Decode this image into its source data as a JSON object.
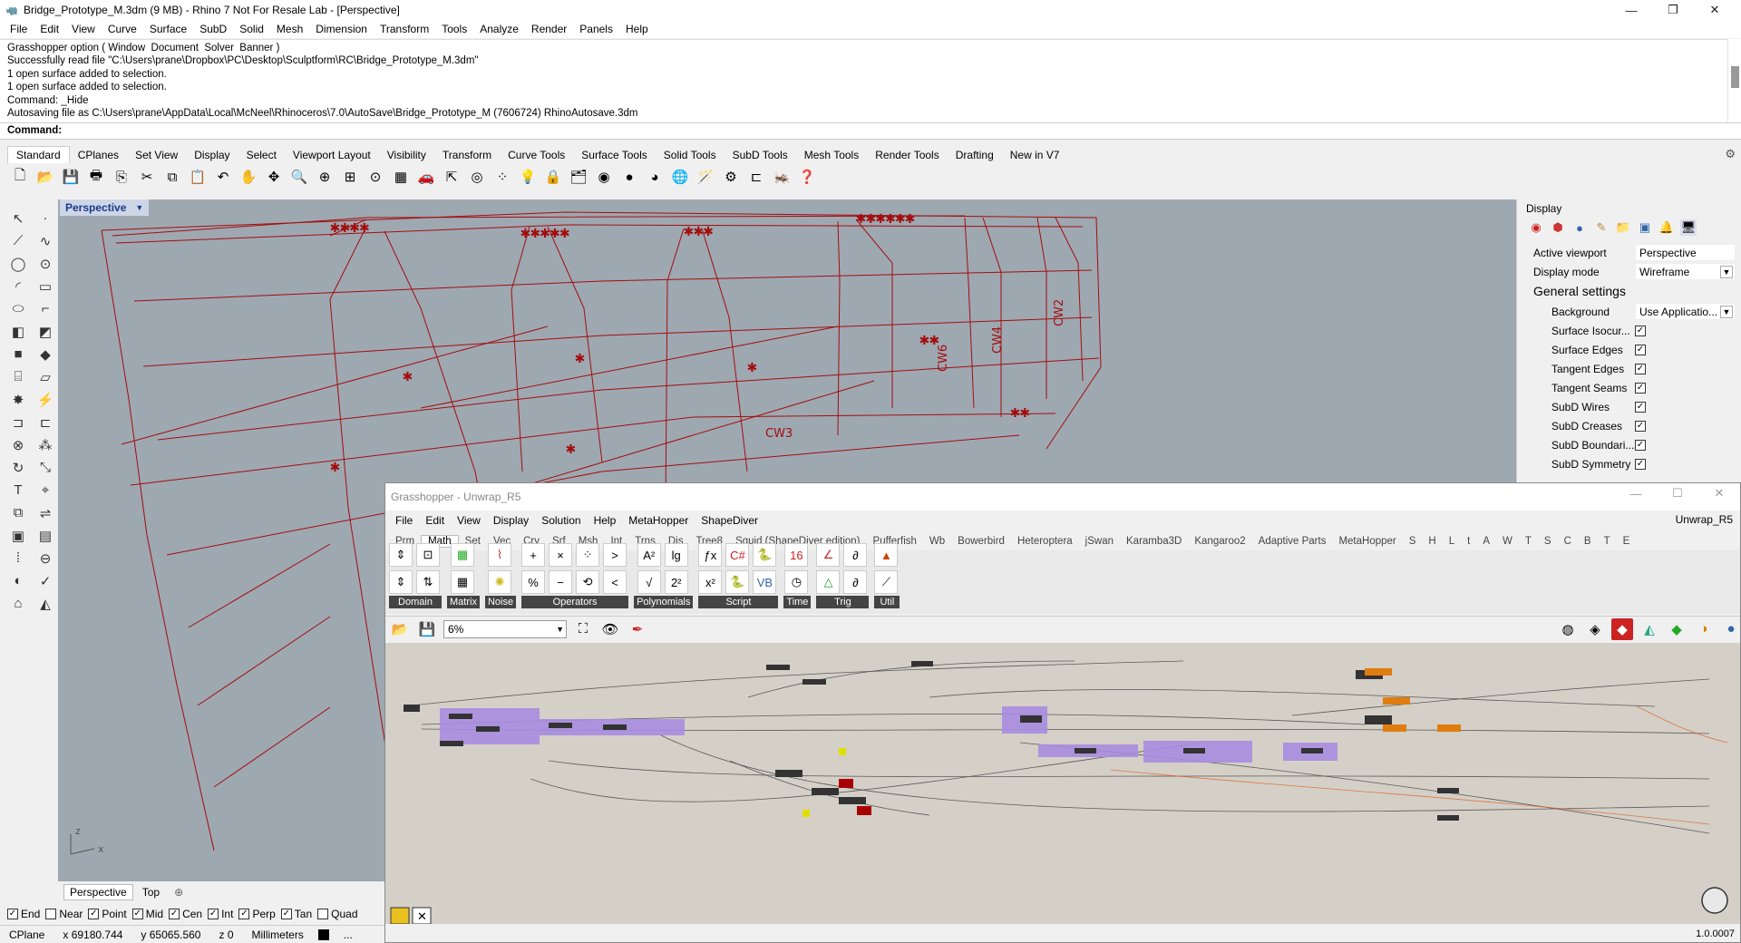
{
  "window": {
    "title": "Bridge_Prototype_M.3dm (9 MB) - Rhino 7 Not For Resale Lab - [Perspective]",
    "minimize": "—",
    "maximize": "❐",
    "close": "✕"
  },
  "menu": [
    "File",
    "Edit",
    "View",
    "Curve",
    "Surface",
    "SubD",
    "Solid",
    "Mesh",
    "Dimension",
    "Transform",
    "Tools",
    "Analyze",
    "Render",
    "Panels",
    "Help"
  ],
  "command_history": [
    "Grasshopper option ( Window  Document  Solver  Banner )",
    "Successfully read file \"C:\\Users\\prane\\Dropbox\\PC\\Desktop\\Sculptform\\RC\\Bridge_Prototype_M.3dm\"",
    "1 open surface added to selection.",
    "1 open surface added to selection.",
    "Command: _Hide",
    "Autosaving file as C:\\Users\\prane\\AppData\\Local\\McNeel\\Rhinoceros\\7.0\\AutoSave\\Bridge_Prototype_M (7606724) RhinoAutosave.3dm"
  ],
  "command_prompt": "Command:",
  "toolbar_tabs": [
    "Standard",
    "CPlanes",
    "Set View",
    "Display",
    "Select",
    "Viewport Layout",
    "Visibility",
    "Transform",
    "Curve Tools",
    "Surface Tools",
    "Solid Tools",
    "SubD Tools",
    "Mesh Tools",
    "Render Tools",
    "Drafting",
    "New in V7"
  ],
  "viewport": {
    "name": "Perspective",
    "labels": [
      "CW3",
      "CW6",
      "CW4",
      "CW2"
    ],
    "axis_x": "x",
    "axis_z": "z"
  },
  "viewport_tabs": [
    "Perspective",
    "Top"
  ],
  "osnaps": [
    {
      "label": "End",
      "checked": true
    },
    {
      "label": "Near",
      "checked": false
    },
    {
      "label": "Point",
      "checked": true
    },
    {
      "label": "Mid",
      "checked": true
    },
    {
      "label": "Cen",
      "checked": true
    },
    {
      "label": "Int",
      "checked": true
    },
    {
      "label": "Perp",
      "checked": true
    },
    {
      "label": "Tan",
      "checked": true
    },
    {
      "label": "Quad",
      "checked": false
    }
  ],
  "status": {
    "cplane": "CPlane",
    "x": "x 69180.744",
    "y": "y 65065.560",
    "z": "z 0",
    "units": "Millimeters",
    "dots": "..."
  },
  "display_panel": {
    "title": "Display",
    "active_viewport_label": "Active viewport",
    "active_viewport": "Perspective",
    "display_mode_label": "Display mode",
    "display_mode": "Wireframe",
    "section": "General settings",
    "background_label": "Background",
    "background": "Use Applicatio...",
    "checks": [
      "Surface Isocur...",
      "Surface Edges",
      "Tangent Edges",
      "Tangent Seams",
      "SubD Wires",
      "SubD Creases",
      "SubD Boundari...",
      "SubD Symmetry"
    ]
  },
  "grasshopper": {
    "title": "Grasshopper - Unwrap_R5",
    "doc": "Unwrap_R5",
    "menu": [
      "File",
      "Edit",
      "View",
      "Display",
      "Solution",
      "Help",
      "MetaHopper",
      "ShapeDiver"
    ],
    "tabs": [
      "Prm",
      "Math",
      "Set",
      "Vec",
      "Crv",
      "Srf",
      "Msh",
      "Int",
      "Trns",
      "Dis",
      "Tree8",
      "Squid (ShapeDiver edition)",
      "Pufferfish",
      "Wb",
      "Bowerbird",
      "Heteroptera",
      "jSwan",
      "Karamba3D",
      "Kangaroo2",
      "Adaptive Parts",
      "MetaHopper",
      "S",
      "H",
      "L",
      "t",
      "A",
      "W",
      "T",
      "S",
      "C",
      "B",
      "T",
      "E"
    ],
    "active_tab": "Math",
    "panels": [
      "Domain",
      "Matrix",
      "Noise",
      "Operators",
      "Polynomials",
      "Script",
      "Time",
      "Trig",
      "Util"
    ],
    "zoom": "6%",
    "version": "1.0.0007"
  }
}
